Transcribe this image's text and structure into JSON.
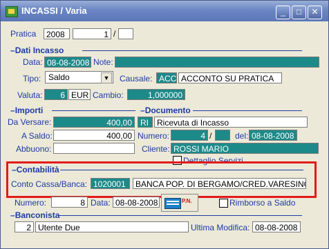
{
  "window": {
    "title": "INCASSI / Varia"
  },
  "pratica": {
    "label": "Pratica",
    "num": "2008",
    "seq": "1",
    "sep": "/",
    "suffix": ""
  },
  "dati_incasso": {
    "section": "Dati Incasso",
    "data_label": "Data:",
    "data_value": "08-08-2008",
    "note_label": "Note:",
    "note_value": "",
    "tipo_label": "Tipo:",
    "tipo_value": "Saldo",
    "causale_label": "Causale:",
    "causale_code": "ACC",
    "causale_desc": "ACCONTO SU PRATICA",
    "valuta_label": "Valuta:",
    "valuta_num": "6",
    "valuta_code": "EUR",
    "cambio_label": "Cambio:",
    "cambio_value": "1,000000"
  },
  "importi": {
    "section": "Importi",
    "da_versare_label": "Da Versare:",
    "da_versare_value": "400,00",
    "a_saldo_label": "A Saldo:",
    "a_saldo_value": "400,00",
    "abbuono_label": "Abbuono:",
    "abbuono_value": ""
  },
  "documento": {
    "section": "Documento",
    "code": "RI",
    "desc": "Ricevuta di Incasso",
    "numero_label": "Numero:",
    "numero_value": "4",
    "sep": "/",
    "suffix": "",
    "del_label": "del:",
    "del_value": "08-08-2008",
    "cliente_label": "Cliente:",
    "cliente_value": "ROSSI MARIO",
    "dettaglio_label": "Dettaglio Servizi"
  },
  "contabilita": {
    "section": "Contabilità",
    "conto_label": "Conto Cassa/Banca:",
    "conto_code": "1020001",
    "conto_desc": "BANCA POP. DI BERGAMO/CRED.VARESINO"
  },
  "bottom": {
    "numero_label": "Numero:",
    "numero_value": "8",
    "data_label": "Data:",
    "data_value": "08-08-2008",
    "pn_label": "P.N.",
    "rimborso_label": "Rimborso a Saldo"
  },
  "banconista": {
    "section": "Banconista",
    "id": "2",
    "name": "Utente Due",
    "ultima_label": "Ultima Modifica:",
    "ultima_value": "08-08-2008"
  },
  "colors": {
    "accent": "#1d8a8a",
    "label": "#1c3aa6",
    "highlight": "#e21a1a"
  }
}
